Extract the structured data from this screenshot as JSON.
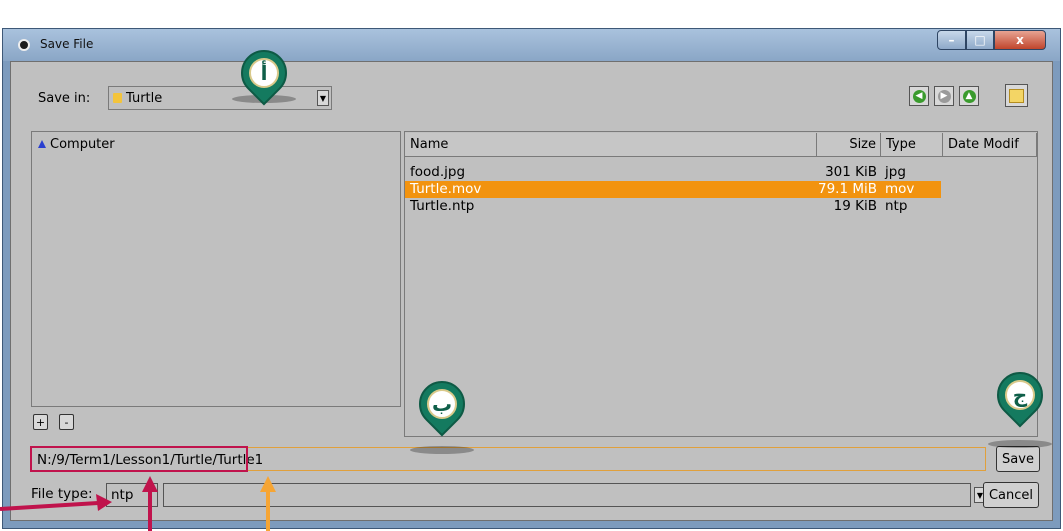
{
  "window": {
    "title": "Save File",
    "min_label": "–",
    "max_label": "□",
    "close_label": "x"
  },
  "save_in": {
    "label": "Save in:",
    "value": "Turtle"
  },
  "sidebar": {
    "items": [
      {
        "label": "Computer"
      }
    ],
    "add_label": "+",
    "remove_label": "-"
  },
  "file_list": {
    "columns": {
      "name": "Name",
      "size": "Size",
      "type": "Type",
      "date": "Date Modif"
    },
    "rows": [
      {
        "name": "food.jpg",
        "size": "301 KiB",
        "type": "jpg",
        "selected": false
      },
      {
        "name": "Turtle.mov",
        "size": "79.1 MiB",
        "type": "mov",
        "selected": true
      },
      {
        "name": "Turtle.ntp",
        "size": "19 KiB",
        "type": "ntp",
        "selected": false
      }
    ]
  },
  "filename": {
    "path": "N:/9/Term1/Lesson1/Turtle/",
    "name": "Turtle1"
  },
  "buttons": {
    "save": "Save",
    "cancel": "Cancel"
  },
  "file_type": {
    "label": "File type:",
    "value": "ntp"
  },
  "markers": {
    "a": "أ",
    "b": "ب",
    "c": "ج"
  },
  "colors": {
    "selection": "#f2930f",
    "marker": "#147a5f",
    "highlight_red": "#c0134c",
    "highlight_orange": "#f6a534"
  }
}
